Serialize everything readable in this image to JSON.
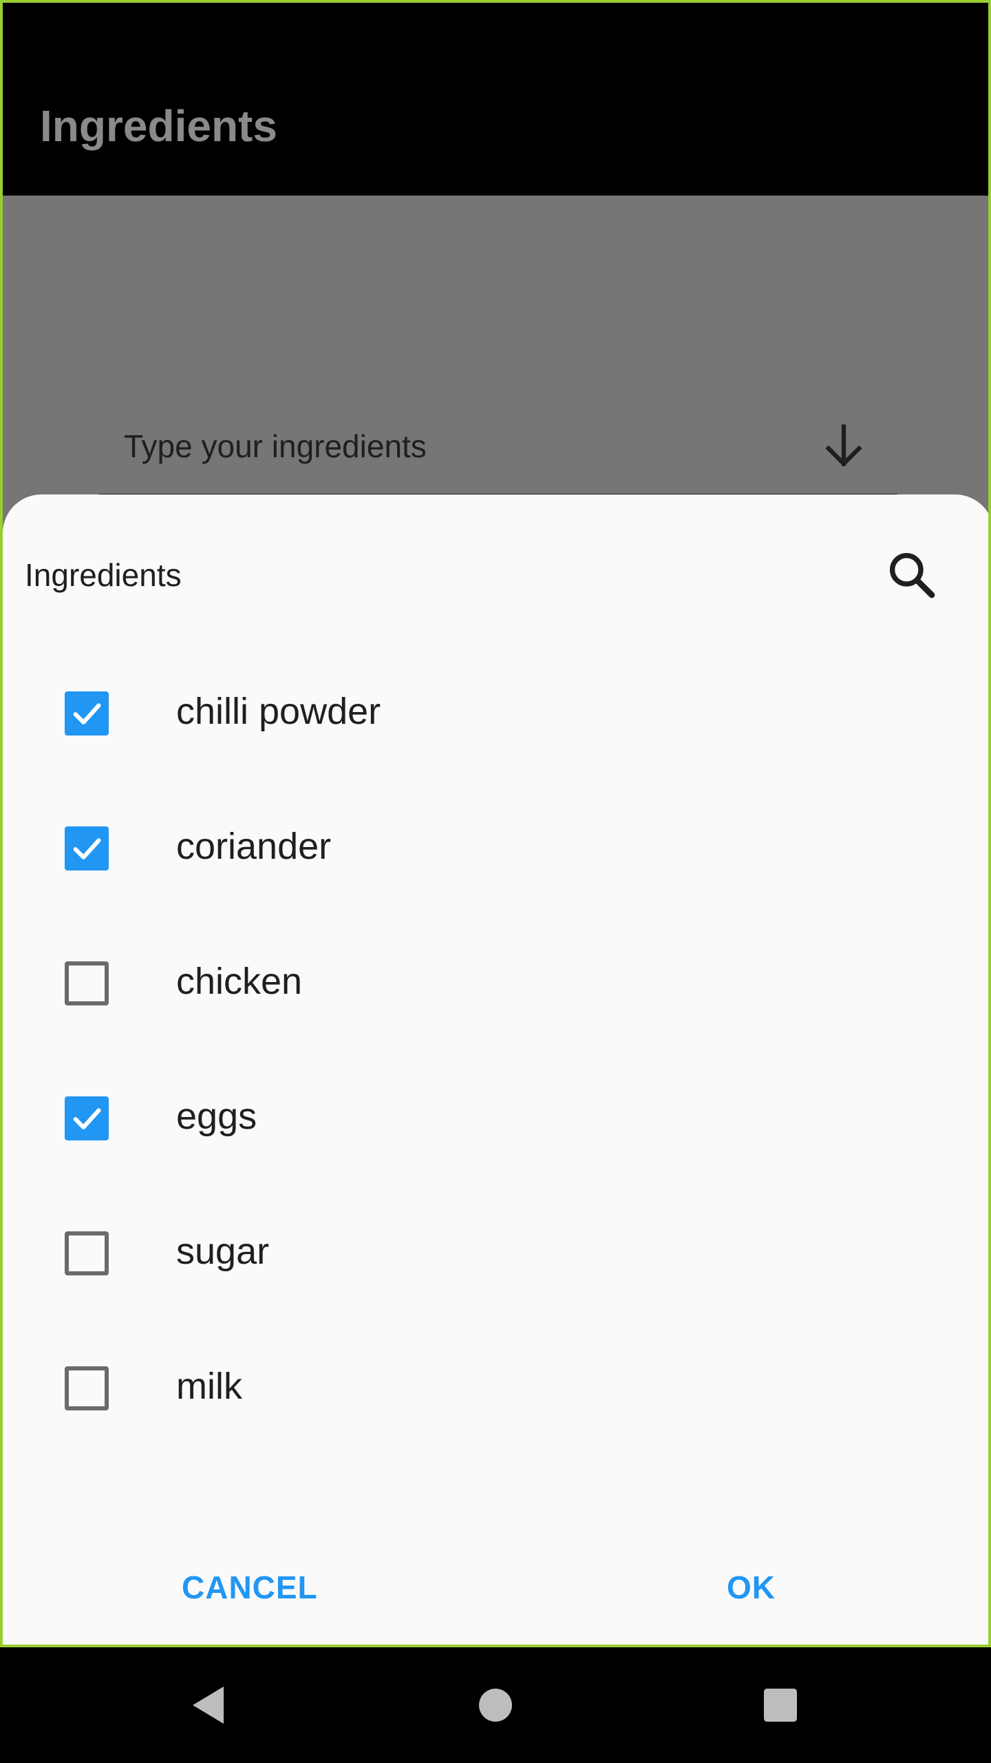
{
  "app_bar": {
    "title": "Ingredients"
  },
  "ingredient_field": {
    "placeholder": "Type your ingredients"
  },
  "dialog": {
    "title": "Ingredients",
    "items": [
      {
        "label": "chilli powder",
        "checked": true
      },
      {
        "label": "coriander",
        "checked": true
      },
      {
        "label": "chicken",
        "checked": false
      },
      {
        "label": "eggs",
        "checked": true
      },
      {
        "label": "sugar",
        "checked": false
      },
      {
        "label": "milk",
        "checked": false
      }
    ],
    "cancel_label": "CANCEL",
    "ok_label": "OK"
  },
  "colors": {
    "accent": "#2196f3",
    "checkbox_border": "#6b6b6b",
    "scrim": "#767676",
    "frame": "#9acd32"
  },
  "icons": {
    "field_trailing": "arrow-down-icon",
    "dialog_search": "search-icon",
    "nav": [
      "back-icon",
      "home-icon",
      "recent-apps-icon"
    ]
  }
}
